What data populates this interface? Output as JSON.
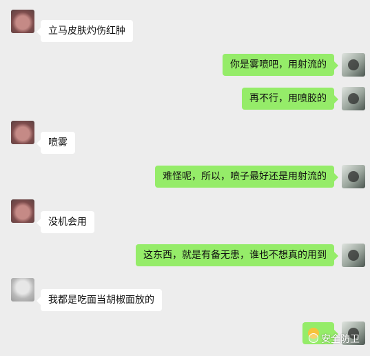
{
  "messages": [
    {
      "sender_name": "",
      "text": "立马皮肤灼伤红肿"
    },
    {
      "text": "你是雾喷吧，用射流的"
    },
    {
      "text": "再不行，用喷胶的"
    },
    {
      "sender_name": "",
      "text": "喷雾"
    },
    {
      "text": "难怪呢，所以，喷子最好还是用射流的"
    },
    {
      "sender_name": "",
      "text": "没机会用"
    },
    {
      "text": "这东西，就是有备无患，谁也不想真的用到"
    },
    {
      "sender_name": "",
      "text": "我都是吃面当胡椒面放的"
    },
    {
      "text": ""
    }
  ],
  "watermark": {
    "text": "安全防卫"
  },
  "colors": {
    "background": "#ededed",
    "incoming_bubble": "#ffffff",
    "outgoing_bubble": "#95ec69",
    "emoji": "#f5c33b"
  },
  "icons": [
    "avatar-icon",
    "emoji-icon",
    "watermark-logo-icon"
  ]
}
